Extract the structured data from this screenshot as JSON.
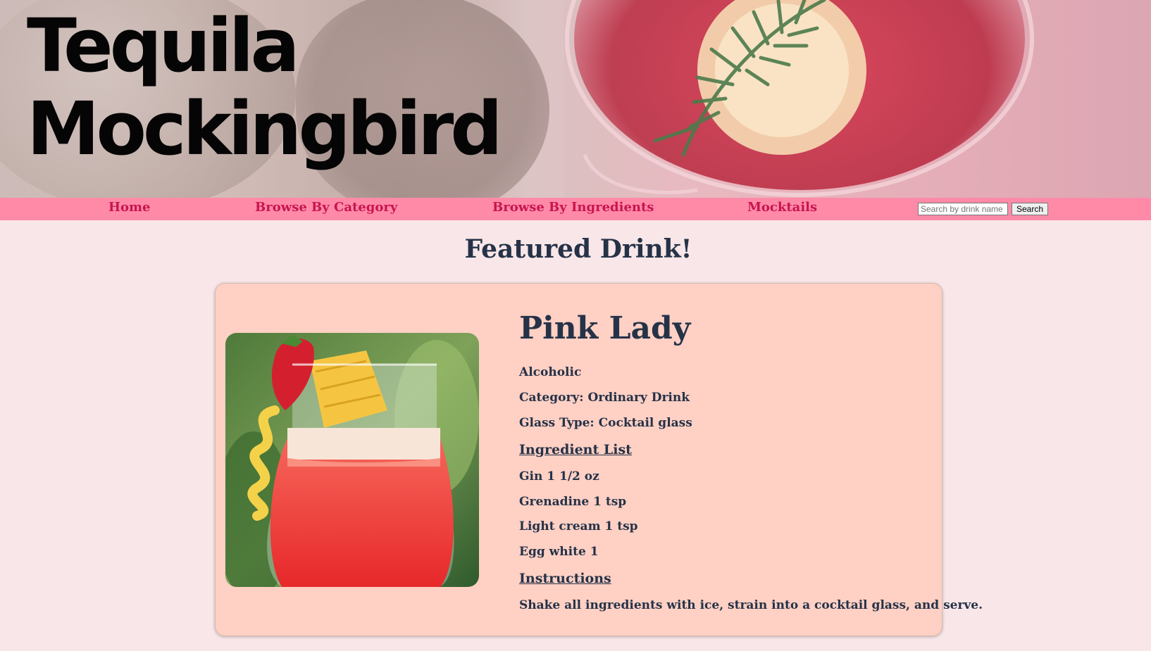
{
  "site": {
    "title_line1": "Tequila",
    "title_line2": "Mockingbird"
  },
  "nav": {
    "items": [
      "Home",
      "Browse By Category",
      "Browse By Ingredients",
      "Mocktails"
    ],
    "search_placeholder": "Search by drink name",
    "search_button": "Search"
  },
  "featured": {
    "heading": "Featured Drink!",
    "drink": {
      "name": "Pink Lady",
      "alcoholic": "Alcoholic",
      "category": "Category: Ordinary Drink",
      "glass": "Glass Type: Cocktail glass",
      "ingredients_heading": "Ingredient List",
      "ingredients": [
        "Gin 1 1/2 oz",
        "Grenadine 1 tsp",
        "Light cream 1 tsp",
        "Egg white 1"
      ],
      "instructions_heading": "Instructions",
      "instructions": "Shake all ingredients with ice, strain into a cocktail glass, and serve."
    }
  },
  "colors": {
    "nav_bg": "#ff8aa8",
    "nav_link": "#c8154e",
    "page_bg": "#f8e6e8",
    "card_bg": "#ffd0c4",
    "text": "#253247"
  }
}
